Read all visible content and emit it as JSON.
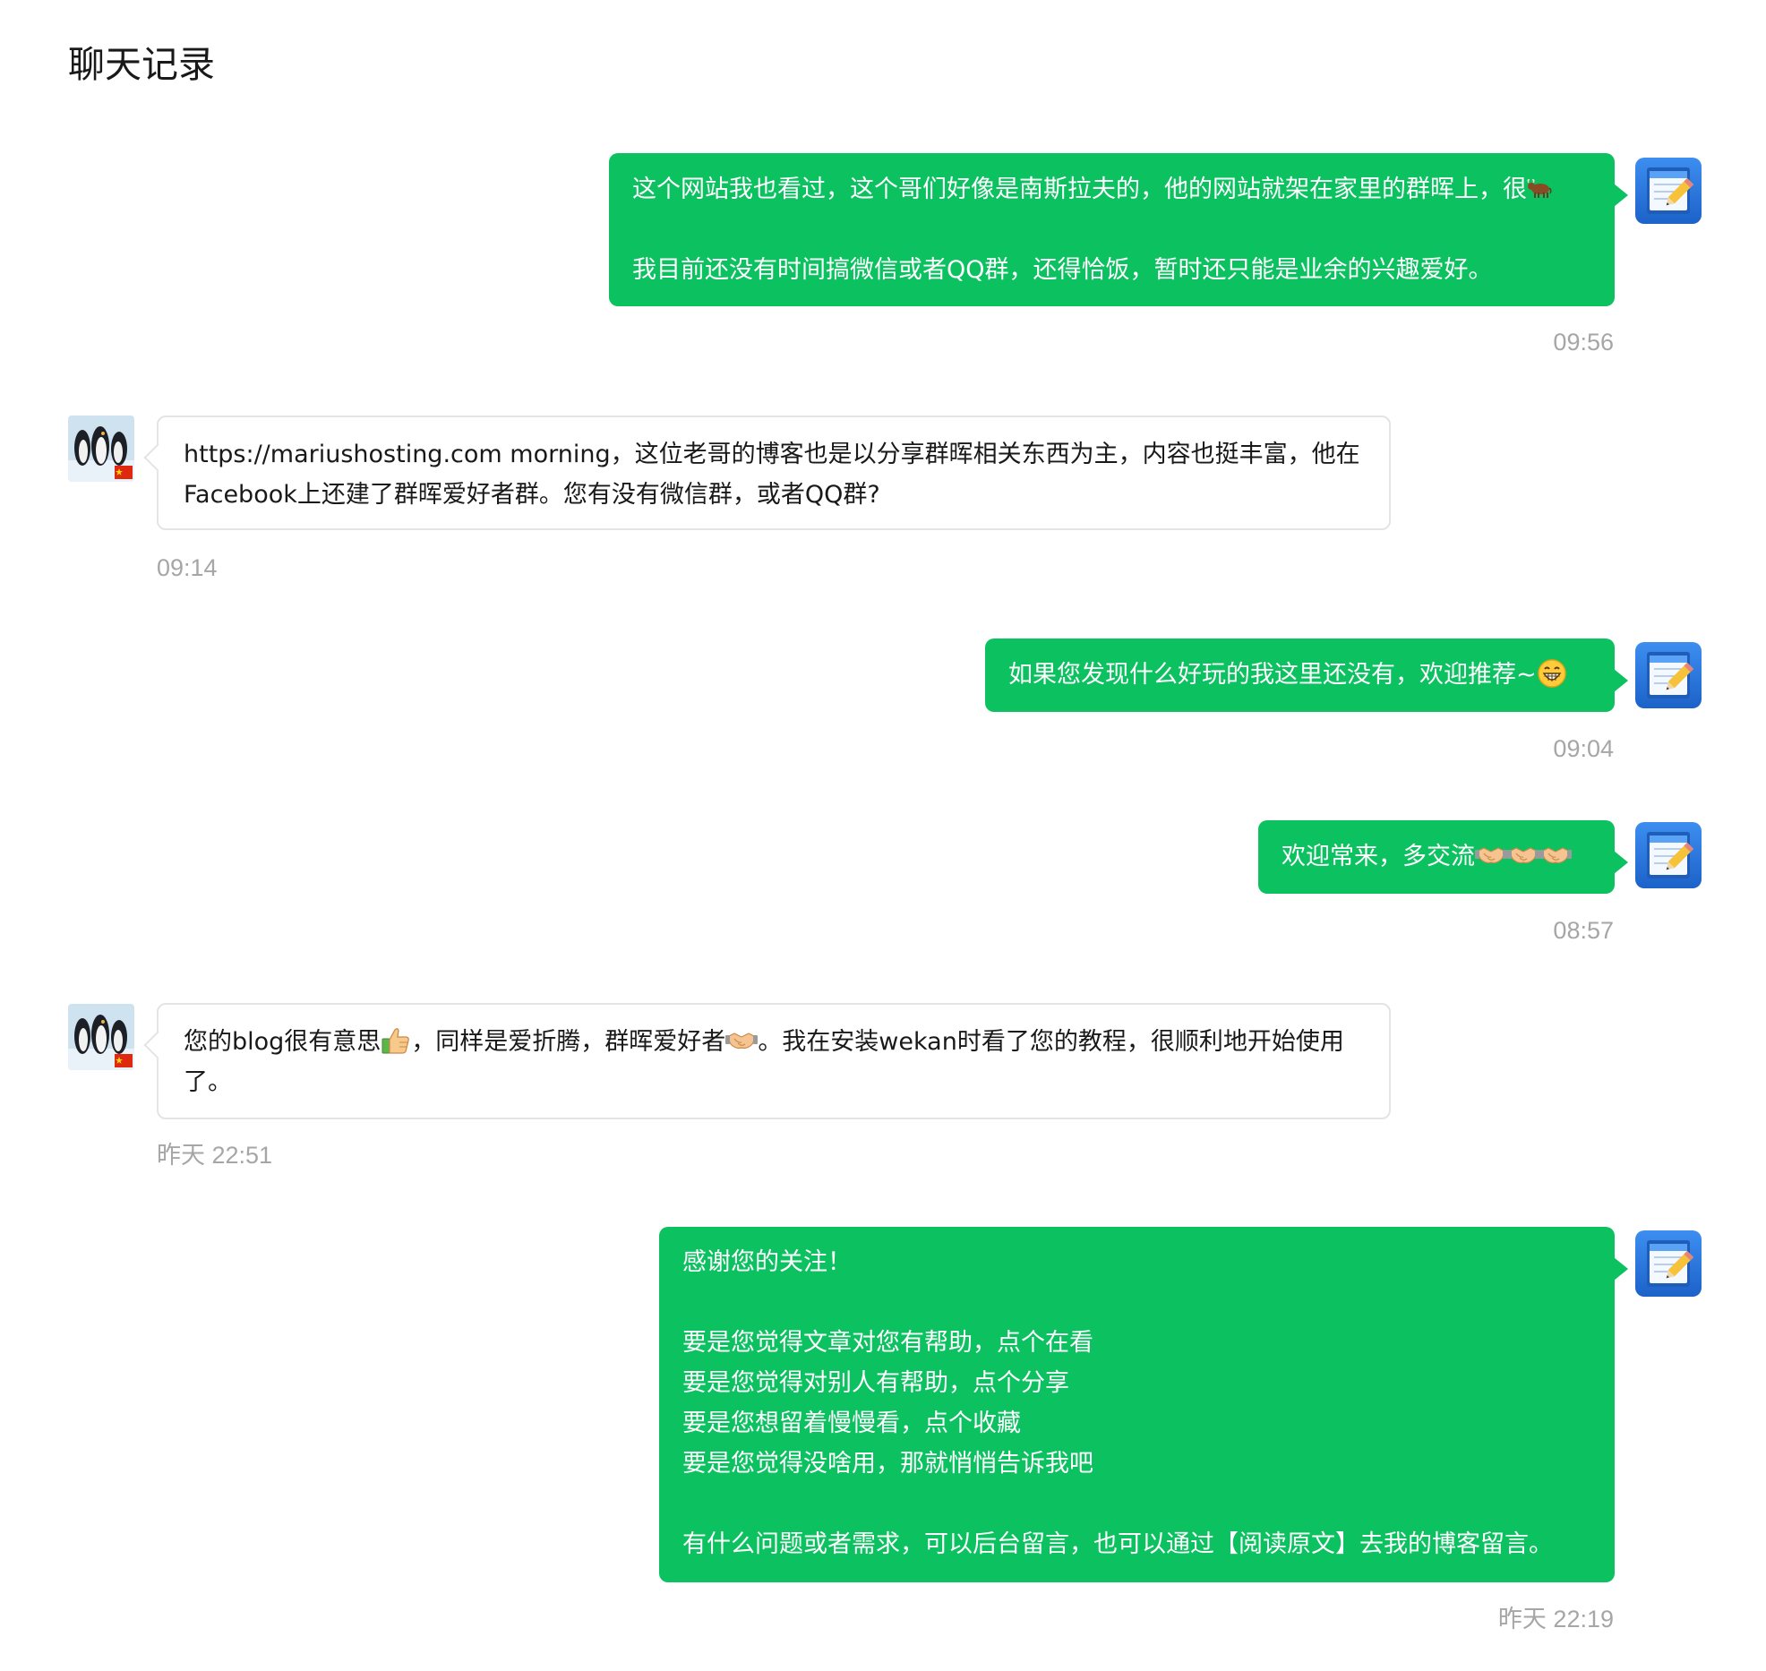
{
  "page": {
    "title": "聊天记录"
  },
  "messages": [
    {
      "direction": "out",
      "avatar": "notepad-pencil-icon",
      "lines": [
        "这个网站我也看过，这个哥们好像是南斯拉夫的，他的网站就架在家里的群晖上，很",
        "",
        "我目前还没有时间搞微信或者QQ群，还得恰饭，暂时还只能是业余的兴趣爱好。"
      ],
      "emoji": [
        "ox-emoji"
      ],
      "time": "09:56"
    },
    {
      "direction": "in",
      "avatar": "penguins-avatar",
      "text": "https://mariushosting.com morning，这位老哥的博客也是以分享群晖相关东西为主，内容也挺丰富，他在Facebook上还建了群晖爱好者群。您有没有微信群，或者QQ群?",
      "time": "09:14"
    },
    {
      "direction": "out",
      "avatar": "notepad-pencil-icon",
      "text": "如果您发现什么好玩的我这里还没有，欢迎推荐~",
      "emoji": [
        "grin-emoji"
      ],
      "time": "09:04"
    },
    {
      "direction": "out",
      "avatar": "notepad-pencil-icon",
      "text": "欢迎常来，多交流",
      "emoji": [
        "handshake-emoji",
        "handshake-emoji",
        "handshake-emoji"
      ],
      "time": "08:57"
    },
    {
      "direction": "in",
      "avatar": "penguins-avatar",
      "parts": [
        "您的blog很有意思",
        "，同样是爱折腾，群晖爱好者",
        "。我在安装wekan时看了您的教程，很顺利地开始使用了。"
      ],
      "emoji": [
        "thumbs-up-emoji",
        "handshake-emoji"
      ],
      "time": "昨天 22:51"
    },
    {
      "direction": "out",
      "avatar": "notepad-pencil-icon",
      "lines": [
        "感谢您的关注！",
        "",
        "要是您觉得文章对您有帮助，点个在看",
        "要是您觉得对别人有帮助，点个分享",
        "要是您想留着慢慢看，点个收藏",
        "要是您觉得没啥用，那就悄悄告诉我吧",
        "",
        "有什么问题或者需求，可以后台留言，也可以通过【阅读原文】去我的博客留言。"
      ],
      "time": "昨天 22:19"
    }
  ],
  "colors": {
    "outgoing_bubble": "#0cc160",
    "incoming_border": "#e4e4e4",
    "timestamp": "#a6a6a6"
  }
}
